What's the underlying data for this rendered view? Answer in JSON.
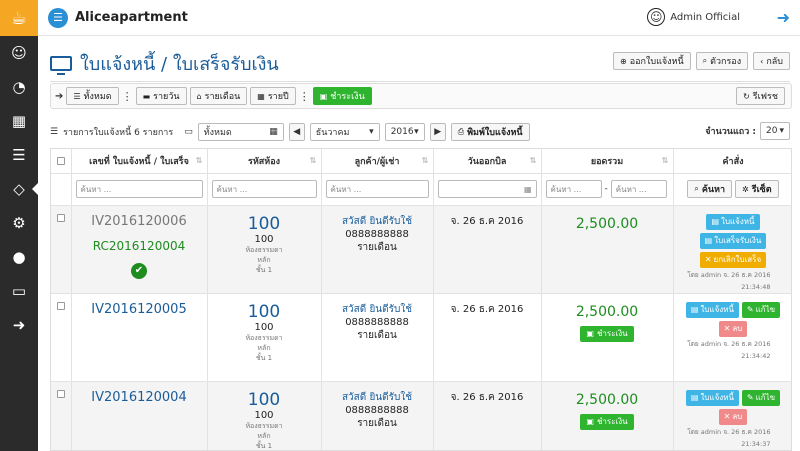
{
  "app": {
    "name": "Aliceapartment"
  },
  "user": {
    "name": "Admin Official"
  },
  "page": {
    "title": "ใบแจ้งหนี้ / ใบเสร็จรับเงิน"
  },
  "title_buttons": {
    "issue": "ออกใบแจ้งหนี้",
    "filter": "ตัวกรอง",
    "back": "กลับ"
  },
  "filterbar": {
    "all": "ทั้งหมด",
    "daily": "รายวัน",
    "monthly": "รายเดือน",
    "yearly": "รายปี",
    "paid": "ชำระเงิน",
    "refresh": "รีเฟรช"
  },
  "controls": {
    "summary": "รายการใบแจ้งหนี้ 6 รายการ",
    "type_value": "ทั้งหมด",
    "month_value": "ธันวาคม",
    "year_value": "2016",
    "print": "พิมพ์ใบแจ้งหนี้",
    "per_page_label": "จำนวนแถว :",
    "per_page_value": "20"
  },
  "table": {
    "headers": [
      "เลขที่ ใบแจ้งหนี้ / ใบเสร็จ",
      "รหัสห้อง",
      "ลูกค้า/ผู้เช่า",
      "วันออกบิล",
      "ยอดรวม",
      "คำสั่ง"
    ],
    "search_placeholder": "ค้นหา ...",
    "range_sep": "-",
    "search_button": "ค้นหา",
    "reset_button": "รีเซ็ต",
    "rows": [
      {
        "invoice": "IV2016120006",
        "receipt": "RC2016120004",
        "room_big": "100",
        "room": "100",
        "room_type": "ห้องธรรมดา",
        "building": "หลัก",
        "floor": "ชั้น 1",
        "customer": "สวัสดี ยินดีรับใช้",
        "phone": "0888888888",
        "rent_type": "รายเดือน",
        "date": "จ. 26 ธ.ค 2016",
        "amount": "2,500.00",
        "btn1": "ใบแจ้งหนี้",
        "btn2": "ใบเสร็จรับเงิน",
        "btn3": "ยกเลิกใบเสร็จ",
        "meta1": "โดย admin จ. 26 ธ.ค 2016",
        "meta2": "21:34:48"
      },
      {
        "invoice": "IV2016120005",
        "room_big": "100",
        "room": "100",
        "room_type": "ห้องธรรมดา",
        "building": "หลัก",
        "floor": "ชั้น 1",
        "customer": "สวัสดี ยินดีรับใช้",
        "phone": "0888888888",
        "rent_type": "รายเดือน",
        "date": "จ. 26 ธ.ค 2016",
        "amount": "2,500.00",
        "pay": "ชำระเงิน",
        "btn1": "ใบแจ้งหนี้",
        "btn2": "แก้ไข",
        "btn3": "ลบ",
        "meta1": "โดย admin จ. 26 ธ.ค 2016",
        "meta2": "21:34:42"
      },
      {
        "invoice": "IV2016120004",
        "room_big": "100",
        "room": "100",
        "room_type": "ห้องธรรมดา",
        "building": "หลัก",
        "floor": "ชั้น 1",
        "customer": "สวัสดี ยินดีรับใช้",
        "phone": "0888888888",
        "rent_type": "รายเดือน",
        "date": "จ. 26 ธ.ค 2016",
        "amount": "2,500.00",
        "pay": "ชำระเงิน",
        "btn1": "ใบแจ้งหนี้",
        "btn2": "แก้ไข",
        "btn3": "ลบ",
        "meta1": "โดย admin จ. 26 ธ.ค 2016",
        "meta2": "21:34:37"
      }
    ]
  },
  "colors": {
    "primary": "#1a5c99",
    "accent": "#2a8fd4",
    "success": "#2fb42f",
    "sidebar": "#2b2b2b",
    "logo": "#f5a623"
  }
}
